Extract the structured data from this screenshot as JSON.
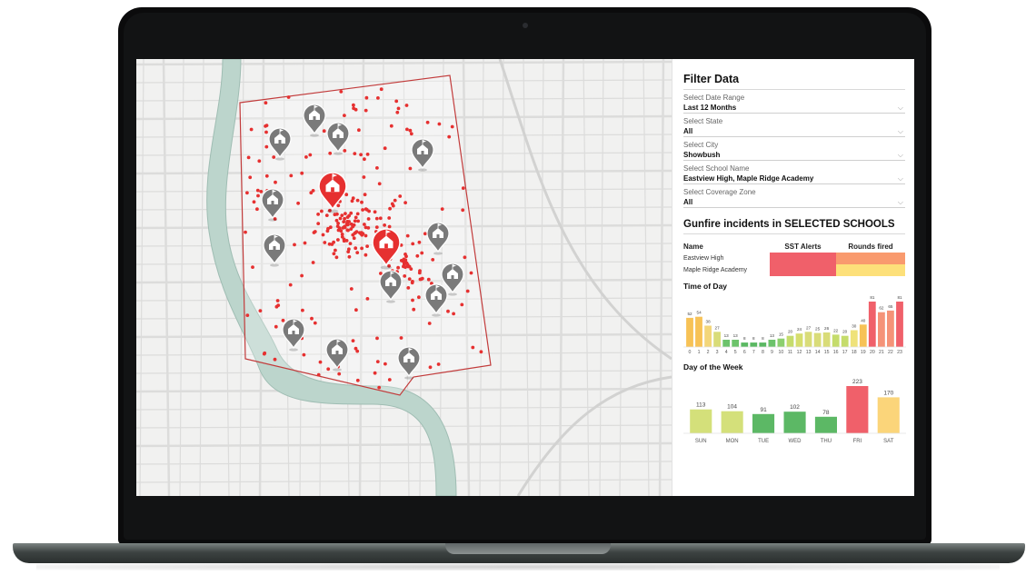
{
  "filter": {
    "title": "Filter Data",
    "fields": [
      {
        "label": "Select Date Range",
        "value": "Last 12 Months"
      },
      {
        "label": "Select State",
        "value": "All"
      },
      {
        "label": "Select City",
        "value": "Showbush"
      },
      {
        "label": "Select School Name",
        "value": "Eastview High, Maple Ridge Academy"
      },
      {
        "label": "Select Coverage Zone",
        "value": "All"
      }
    ]
  },
  "incidents": {
    "title": "Gunfire incidents in SELECTED SCHOOLS",
    "columns": [
      "Name",
      "SST Alerts",
      "Rounds fired"
    ],
    "rows": [
      {
        "name": "Eastview High",
        "sst_color": "#f0606a",
        "rounds_color": "#f99a6e"
      },
      {
        "name": "Maple Ridge Academy",
        "sst_color": "#f0606a",
        "rounds_color": "#fde07a"
      }
    ]
  },
  "time_of_day": {
    "title": "Time of Day",
    "chart_data": {
      "type": "bar",
      "categories": [
        "0",
        "1",
        "2",
        "3",
        "4",
        "5",
        "6",
        "7",
        "8",
        "9",
        "10",
        "11",
        "12",
        "13",
        "14",
        "15",
        "16",
        "17",
        "18",
        "19",
        "20",
        "21",
        "22",
        "23"
      ],
      "values": [
        52,
        54,
        38,
        27,
        13,
        13,
        8,
        8,
        8,
        13,
        15,
        20,
        24,
        27,
        25,
        26,
        22,
        20,
        30,
        40,
        81,
        62,
        65,
        81
      ],
      "colors": [
        "#f7c256",
        "#f7c256",
        "#f3d67a",
        "#d9dc78",
        "#6cc36b",
        "#6cc36b",
        "#5ab862",
        "#5ab862",
        "#5ab862",
        "#6cc36b",
        "#8ccf6f",
        "#c5dc6c",
        "#d6de6e",
        "#d9dc78",
        "#d9dc78",
        "#d9dc78",
        "#c5dc6c",
        "#c5dc6c",
        "#efe27a",
        "#f7c256",
        "#f0606a",
        "#f59378",
        "#f59378",
        "#f0606a"
      ]
    }
  },
  "day_of_week": {
    "title": "Day of the Week",
    "chart_data": {
      "type": "bar",
      "categories": [
        "SUN",
        "MON",
        "TUE",
        "WED",
        "THU",
        "FRI",
        "SAT"
      ],
      "values": [
        113,
        104,
        91,
        102,
        78,
        223,
        170
      ],
      "colors": [
        "#d4e07a",
        "#d4e07a",
        "#5cb865",
        "#5cb865",
        "#5cb865",
        "#f0606a",
        "#fbd57a"
      ]
    }
  },
  "map": {
    "boundary_color": "#c23b3b",
    "incident_color": "#e63030",
    "school_icon_color": "#7a7a7a",
    "selected_school_color": "#e63030"
  }
}
